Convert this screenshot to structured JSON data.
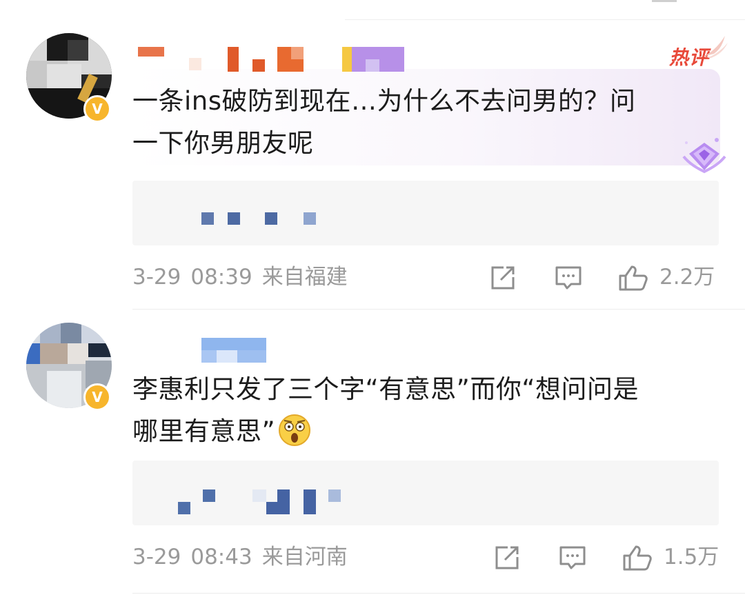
{
  "comments": [
    {
      "text_line1": "一条ins破防到现在…为什么不去问男的？问",
      "text_line2": "一下你男朋友呢",
      "badge": "热评",
      "date": "3-29",
      "time": "08:39",
      "location": "来自福建",
      "likes": "2.2万",
      "verified_mark": "V"
    },
    {
      "text_line1": "李惠利只发了三个字“有意思”而你“想问问是",
      "text_line2": "哪里有意思”",
      "date": "3-29",
      "time": "08:43",
      "location": "来自河南",
      "likes": "1.5万",
      "verified_mark": "V"
    }
  ],
  "icons": {
    "share": "share-icon",
    "comment": "comment-icon",
    "like": "like-icon",
    "emoji": "shocked-face-emoji",
    "hot_badge": "hot-wing-icon",
    "rank_badge": "diamond-badge-icon"
  },
  "colors": {
    "hot_label": "#e8493a",
    "verified": "#f7b52c",
    "meta_text": "#9a9a9a",
    "reply_bg": "#f6f6f6"
  }
}
